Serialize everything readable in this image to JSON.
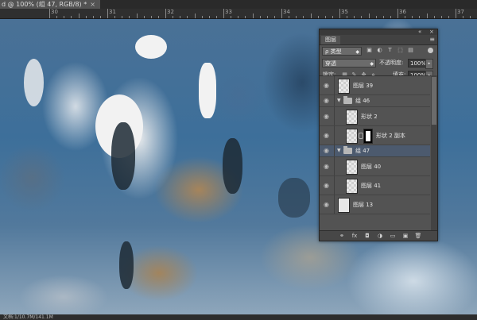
{
  "document_tab": {
    "title": "d @ 100% (组 47, RGB/8) *",
    "close": "×"
  },
  "ruler": {
    "labels": [
      "30",
      "31",
      "32",
      "33",
      "34",
      "35",
      "36",
      "37"
    ]
  },
  "status_bar": {
    "text": "文档:1/10.7M/141.1M"
  },
  "layers_panel": {
    "topbar_controls": [
      "«",
      "×"
    ],
    "tab_label": "图层",
    "menu_icon": "≡",
    "filter": {
      "label": "ρ 类型",
      "icons": [
        "image-filter-icon",
        "adjustment-filter-icon",
        "text-filter-icon",
        "shape-filter-icon",
        "smart-object-filter-icon"
      ]
    },
    "blend": {
      "mode": "穿透",
      "opacity_label": "不透明度:",
      "opacity_value": "100%"
    },
    "lock": {
      "label": "锁定:",
      "fill_label": "填充:",
      "fill_value": "100%"
    },
    "layers": [
      {
        "name": "图层 39",
        "kind": "layer",
        "indent": 0,
        "selected": false
      },
      {
        "name": "组 46",
        "kind": "group",
        "indent": 0,
        "selected": false
      },
      {
        "name": "形状 2",
        "kind": "layer",
        "indent": 1,
        "selected": false
      },
      {
        "name": "形状 2 副本",
        "kind": "layer-mask",
        "indent": 1,
        "selected": false
      },
      {
        "name": "组 47",
        "kind": "group",
        "indent": 0,
        "selected": true
      },
      {
        "name": "图层 40",
        "kind": "layer",
        "indent": 1,
        "selected": false
      },
      {
        "name": "图层 41",
        "kind": "layer",
        "indent": 1,
        "selected": false
      },
      {
        "name": "图层 13",
        "kind": "solid-layer",
        "indent": 0,
        "selected": false
      }
    ],
    "footer_icons": [
      "link-layers-icon",
      "fx-icon",
      "add-mask-icon",
      "adjustment-icon",
      "new-group-icon",
      "new-layer-icon",
      "delete-icon"
    ],
    "footer_glyphs": [
      "⚭",
      "fx",
      "◘",
      "◑",
      "▭",
      "▣",
      "🗑"
    ]
  }
}
